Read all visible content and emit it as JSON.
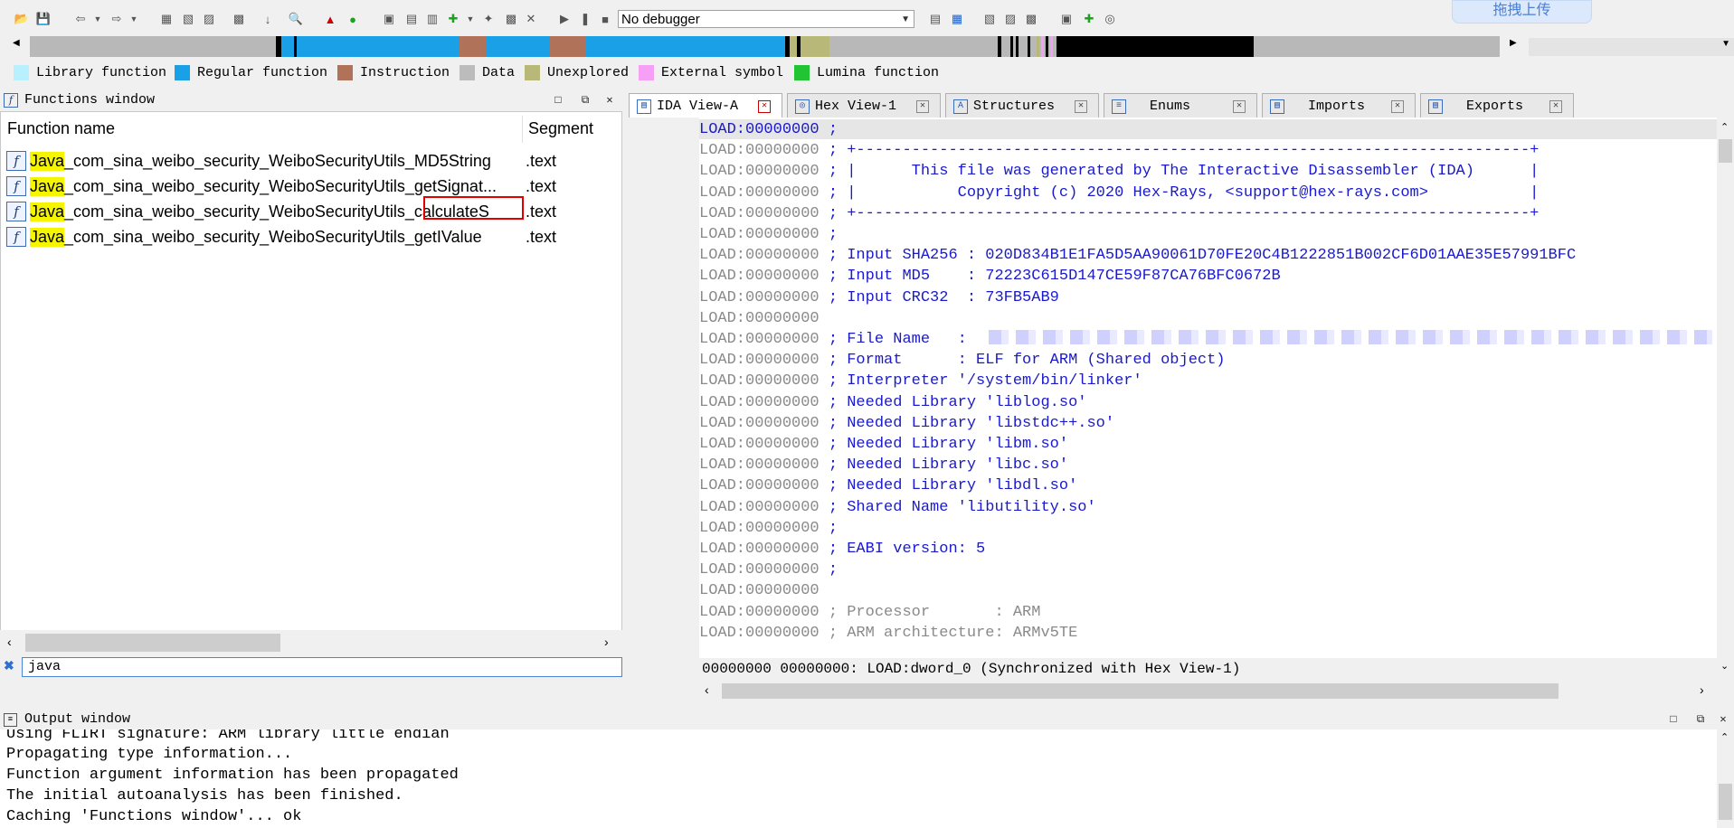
{
  "toolbar": {
    "debugger_select": "No debugger",
    "upload_button": "拖拽上传"
  },
  "legend": [
    {
      "label": "Library function",
      "color": "#b8f0ff"
    },
    {
      "label": "Regular function",
      "color": "#1aa0e6"
    },
    {
      "label": "Instruction",
      "color": "#b0735a"
    },
    {
      "label": "Data",
      "color": "#bcbcbc"
    },
    {
      "label": "Unexplored",
      "color": "#b8b878"
    },
    {
      "label": "External symbol",
      "color": "#f5a0f5"
    },
    {
      "label": "Lumina function",
      "color": "#22c434"
    }
  ],
  "functions_window": {
    "title": "Functions window",
    "col_name": "Function name",
    "col_segment": "Segment",
    "rows": [
      {
        "highlight": "Java",
        "rest": "_com_sina_weibo_security_WeiboSecurityUtils_MD5String",
        "segment": ".text"
      },
      {
        "highlight": "Java",
        "rest": "_com_sina_weibo_security_WeiboSecurityUtils_getSignat...",
        "segment": ".text"
      },
      {
        "highlight": "Java",
        "rest": "_com_sina_weibo_security_WeiboSecurityUtils_calculateS",
        "segment": ".text"
      },
      {
        "highlight": "Java",
        "rest": "_com_sina_weibo_security_WeiboSecurityUtils_getIValue",
        "segment": ".text"
      }
    ],
    "filter_value": "java"
  },
  "tabs": [
    {
      "label": "IDA View-A",
      "active": true
    },
    {
      "label": "Hex View-1",
      "active": false
    },
    {
      "label": "Structures",
      "active": false
    },
    {
      "label": "Enums",
      "active": false
    },
    {
      "label": "Imports",
      "active": false
    },
    {
      "label": "Exports",
      "active": false
    }
  ],
  "ida_view": {
    "lines": [
      {
        "addr": "LOAD:00000000",
        "text": " ;",
        "style": "cmt"
      },
      {
        "addr": "LOAD:00000000",
        "text": " ; +-------------------------------------------------------------------------+",
        "style": "cmt"
      },
      {
        "addr": "LOAD:00000000",
        "text": " ; |      This file was generated by The Interactive Disassembler (IDA)      |",
        "style": "cmt"
      },
      {
        "addr": "LOAD:00000000",
        "text": " ; |           Copyright (c) 2020 Hex-Rays, <support@hex-rays.com>           |",
        "style": "cmt"
      },
      {
        "addr": "LOAD:00000000",
        "text": " ; +-------------------------------------------------------------------------+",
        "style": "cmt"
      },
      {
        "addr": "LOAD:00000000",
        "text": " ;",
        "style": "cmt"
      },
      {
        "addr": "LOAD:00000000",
        "text": " ; Input SHA256 : 020D834B1E1FA5D5AA90061D70FE20C4B1222851B002CF6D01AAE35E57991BFC",
        "style": "cmt"
      },
      {
        "addr": "LOAD:00000000",
        "text": " ; Input MD5    : 72223C615D147CE59F87CA76BFC0672B",
        "style": "cmt"
      },
      {
        "addr": "LOAD:00000000",
        "text": " ; Input CRC32  : 73FB5AB9",
        "style": "cmt"
      },
      {
        "addr": "LOAD:00000000",
        "text": "",
        "style": "cmt"
      },
      {
        "addr": "LOAD:00000000",
        "text": " ; File Name   :",
        "style": "cmt"
      },
      {
        "addr": "LOAD:00000000",
        "text": " ; Format      : ELF for ARM (Shared object)",
        "style": "cmt"
      },
      {
        "addr": "LOAD:00000000",
        "text": " ; Interpreter '/system/bin/linker'",
        "style": "cmt"
      },
      {
        "addr": "LOAD:00000000",
        "text": " ; Needed Library 'liblog.so'",
        "style": "cmt"
      },
      {
        "addr": "LOAD:00000000",
        "text": " ; Needed Library 'libstdc++.so'",
        "style": "cmt"
      },
      {
        "addr": "LOAD:00000000",
        "text": " ; Needed Library 'libm.so'",
        "style": "cmt"
      },
      {
        "addr": "LOAD:00000000",
        "text": " ; Needed Library 'libc.so'",
        "style": "cmt"
      },
      {
        "addr": "LOAD:00000000",
        "text": " ; Needed Library 'libdl.so'",
        "style": "cmt"
      },
      {
        "addr": "LOAD:00000000",
        "text": " ; Shared Name 'libutility.so'",
        "style": "cmt"
      },
      {
        "addr": "LOAD:00000000",
        "text": " ;",
        "style": "cmt"
      },
      {
        "addr": "LOAD:00000000",
        "text": " ; EABI version: 5",
        "style": "cmt"
      },
      {
        "addr": "LOAD:00000000",
        "text": " ;",
        "style": "cmt"
      },
      {
        "addr": "LOAD:00000000",
        "text": "",
        "style": "cmt"
      },
      {
        "addr": "LOAD:00000000",
        "text": " ; Processor       : ARM",
        "style": "gray"
      },
      {
        "addr": "LOAD:00000000",
        "text": " ; ARM architecture: ARMv5TE",
        "style": "gray"
      }
    ],
    "status": "00000000 00000000: LOAD:dword_0 (Synchronized with Hex View-1)"
  },
  "output_window": {
    "title": "Output window",
    "lines": [
      "Using FLIRT signature: ARM library little endian",
      "Propagating type information...",
      "Function argument information has been propagated",
      "The initial autoanalysis has been finished.",
      "Caching 'Functions window'... ok"
    ]
  },
  "icons": {
    "toolbar": [
      "open-icon",
      "save-icon",
      "back-icon",
      "dropdown-icon",
      "forward-icon",
      "dropdown-icon",
      "search-binary-icon",
      "search-text-icon",
      "search-imm-icon",
      "jump-icon",
      "down-arrow-icon",
      "find-icon",
      "graph-icon",
      "run-icon",
      "add-icon",
      "add2-icon",
      "export-icon",
      "plus-icon",
      "dropdown-icon",
      "pin-icon",
      "camera-icon",
      "cross-icon",
      "play-icon",
      "pause-icon",
      "stop-icon"
    ]
  }
}
